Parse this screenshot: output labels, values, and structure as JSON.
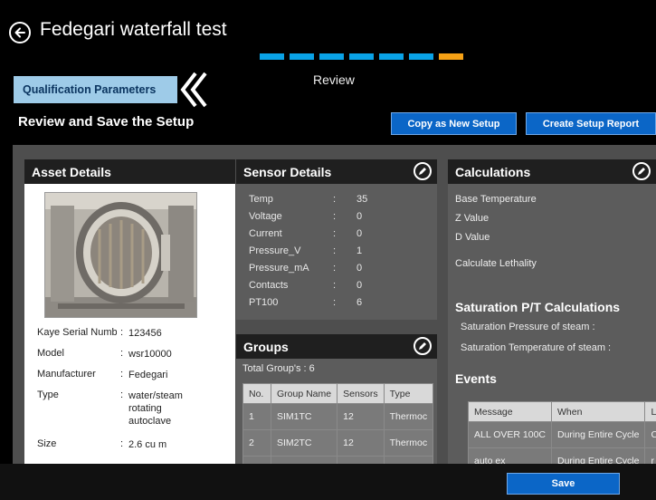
{
  "app": {
    "title": "Fedegari waterfall test"
  },
  "progress": {
    "steps_total": 7,
    "current_step": 7,
    "label": "Review"
  },
  "nav": {
    "qualification_tab": "Qualification Parameters"
  },
  "page": {
    "section_title": "Review and Save the Setup"
  },
  "actions": {
    "copy_label": "Copy as New Setup",
    "report_label": "Create Setup Report",
    "save_label": "Save"
  },
  "colors": {
    "accent_blue": "#0aa2e6",
    "current_step": "#f6a115",
    "button_blue": "#0b66c7",
    "tab_bg": "#9ecbe8"
  },
  "asset": {
    "title": "Asset Details",
    "rows": [
      {
        "key": "Kaye Serial Numb",
        "value": "123456"
      },
      {
        "key": "Model",
        "value": "wsr10000"
      },
      {
        "key": "Manufacturer",
        "value": "Fedegari"
      },
      {
        "key": "Type",
        "value": "water/steam rotating autoclave"
      },
      {
        "key": "Size",
        "value": "2.6 cu m"
      }
    ]
  },
  "sensors": {
    "title": "Sensor Details",
    "rows": [
      {
        "key": "Temp",
        "value": "35"
      },
      {
        "key": "Voltage",
        "value": "0"
      },
      {
        "key": "Current",
        "value": "0"
      },
      {
        "key": "Pressure_V",
        "value": "1"
      },
      {
        "key": "Pressure_mA",
        "value": "0"
      },
      {
        "key": "Contacts",
        "value": "0"
      },
      {
        "key": "PT100",
        "value": "6"
      }
    ]
  },
  "groups": {
    "title": "Groups",
    "total": "Total Group's : 6",
    "columns": [
      "No.",
      "Group Name",
      "Sensors",
      "Type"
    ],
    "rows": [
      [
        "1",
        "SIM1TC",
        "12",
        "Thermoc"
      ],
      [
        "2",
        "SIM2TC",
        "12",
        "Thermoc"
      ]
    ]
  },
  "calculations": {
    "title": "Calculations",
    "items": [
      "Base Temperature",
      "Z Value",
      "D Value",
      "Calculate Lethality"
    ],
    "saturation_title": "Saturation P/T Calculations",
    "saturation_items": [
      "Saturation Pressure of steam :",
      "Saturation Temperature of steam :"
    ],
    "events_title": "Events",
    "events_columns": [
      "Message",
      "When",
      "L"
    ],
    "events_rows": [
      [
        "ALL OVER 100C",
        "During Entire Cycle",
        "C"
      ],
      [
        "auto ex",
        "During Entire Cycle",
        "r"
      ]
    ]
  },
  "icons": {
    "back": "back-arrow-icon",
    "chevron": "double-chevron-left-icon",
    "edit": "edit-pencil-icon"
  }
}
